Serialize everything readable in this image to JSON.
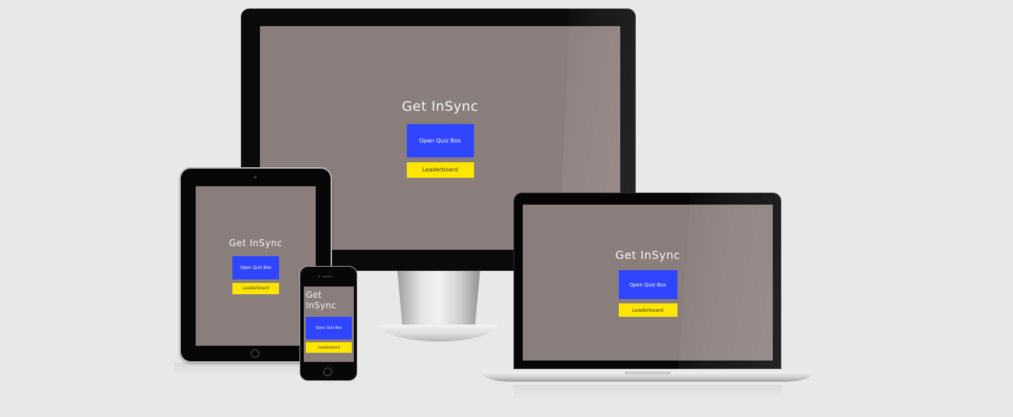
{
  "devices": {
    "desktop": {
      "title": "Get InSync",
      "quiz_button": "Open Quiz Box",
      "leaderboard_button": "Leaderboard"
    },
    "tablet": {
      "title": "Get InSync",
      "quiz_button": "Open Quiz Box",
      "leaderboard_button": "Leaderboard"
    },
    "laptop": {
      "title": "Get InSync",
      "quiz_button": "Open Quiz Box",
      "leaderboard_button": "Leaderboard"
    },
    "phone": {
      "title": "Get InSync",
      "quiz_button": "Open Quiz Box",
      "leaderboard_button": "Leaderboard"
    }
  },
  "colors": {
    "background": "#e8e8e8",
    "screen": "#8a7e7c",
    "quiz_button": "#2f45ff",
    "leaderboard_button": "#ffe600"
  }
}
